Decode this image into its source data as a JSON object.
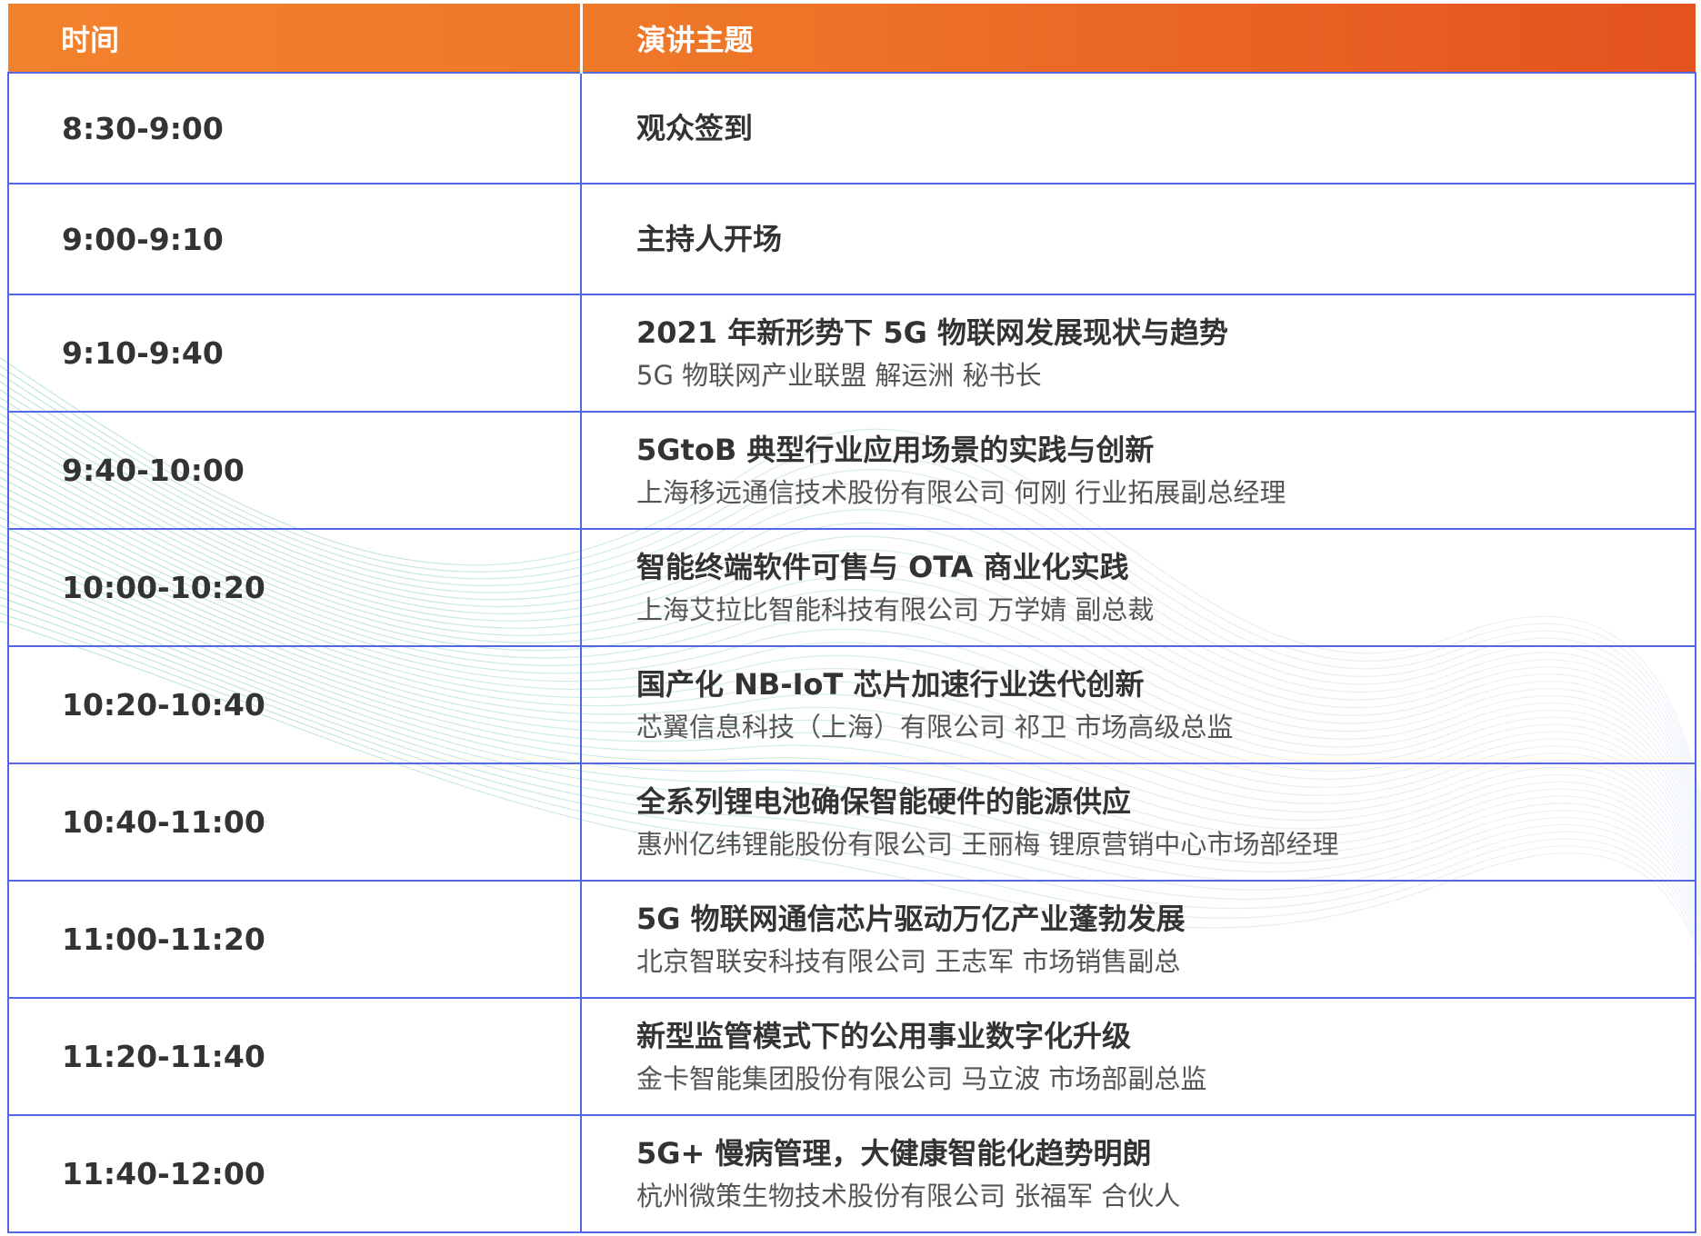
{
  "colors": {
    "header_gradient_start": "#f3822c",
    "header_gradient_end": "#e4521f",
    "grid_line": "#5468e6",
    "text_primary": "#333333",
    "text_secondary": "#555555"
  },
  "header": {
    "time_label": "时间",
    "topic_label": "演讲主题"
  },
  "rows": [
    {
      "time": "8:30-9:00",
      "title": "观众签到",
      "speaker": ""
    },
    {
      "time": "9:00-9:10",
      "title": "主持人开场",
      "speaker": ""
    },
    {
      "time": "9:10-9:40",
      "title": "2021 年新形势下 5G 物联网发展现状与趋势",
      "speaker": "5G 物联网产业联盟 解运洲 秘书长"
    },
    {
      "time": "9:40-10:00",
      "title": "5GtoB 典型行业应用场景的实践与创新",
      "speaker": "上海移远通信技术股份有限公司 何刚 行业拓展副总经理"
    },
    {
      "time": "10:00-10:20",
      "title": "智能终端软件可售与 OTA 商业化实践",
      "speaker": "上海艾拉比智能科技有限公司 万学婧 副总裁"
    },
    {
      "time": "10:20-10:40",
      "title": "国产化 NB-IoT 芯片加速行业迭代创新",
      "speaker": "芯翼信息科技（上海）有限公司 祁卫 市场高级总监"
    },
    {
      "time": "10:40-11:00",
      "title": "全系列锂电池确保智能硬件的能源供应",
      "speaker": "惠州亿纬锂能股份有限公司 王丽梅 锂原营销中心市场部经理"
    },
    {
      "time": "11:00-11:20",
      "title": "5G 物联网通信芯片驱动万亿产业蓬勃发展",
      "speaker": "北京智联安科技有限公司 王志军 市场销售副总"
    },
    {
      "time": "11:20-11:40",
      "title": "新型监管模式下的公用事业数字化升级",
      "speaker": "金卡智能集团股份有限公司 马立波 市场部副总监"
    },
    {
      "time": "11:40-12:00",
      "title": "5G+ 慢病管理，大健康智能化趋势明朗",
      "speaker": "杭州微策生物技术股份有限公司 张福军 合伙人"
    }
  ]
}
